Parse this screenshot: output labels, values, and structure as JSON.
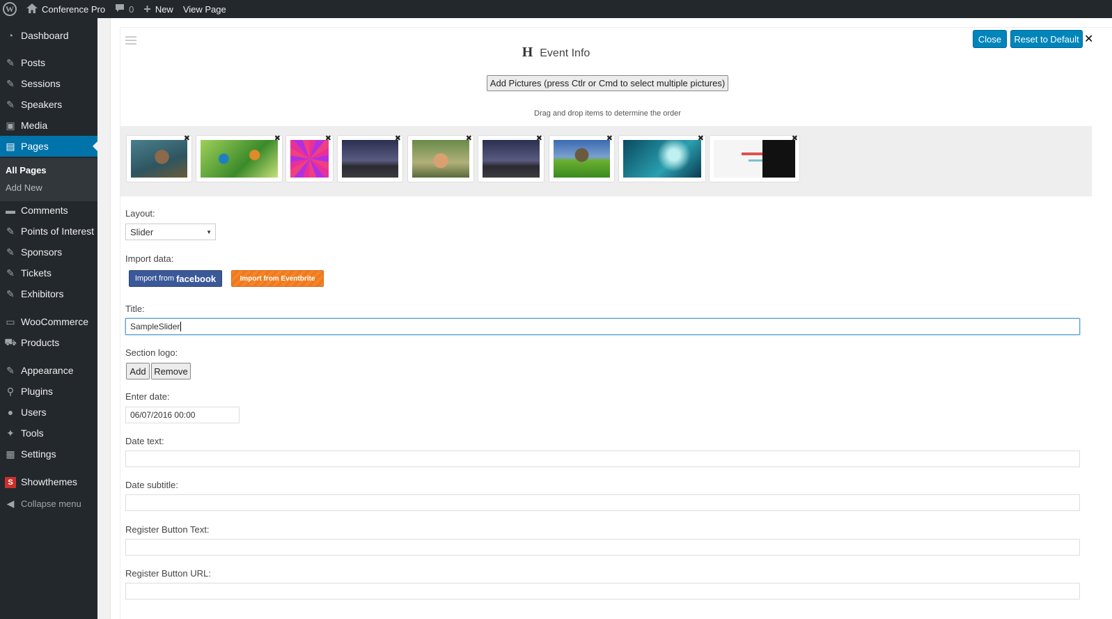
{
  "adminbar": {
    "site_name": "Conference Pro",
    "comments_count": "0",
    "new_label": "New",
    "view_page_label": "View Page"
  },
  "sidebar": {
    "items": [
      {
        "label": "Dashboard",
        "icon": "dashboard-icon"
      },
      {
        "label": "Posts",
        "icon": "pin-icon"
      },
      {
        "label": "Sessions",
        "icon": "pin-icon"
      },
      {
        "label": "Speakers",
        "icon": "pin-icon"
      },
      {
        "label": "Media",
        "icon": "media-icon"
      },
      {
        "label": "Pages",
        "icon": "pages-icon"
      },
      {
        "label": "Comments",
        "icon": "comment-icon"
      },
      {
        "label": "Points of Interest",
        "icon": "pin-icon"
      },
      {
        "label": "Sponsors",
        "icon": "pin-icon"
      },
      {
        "label": "Tickets",
        "icon": "pin-icon"
      },
      {
        "label": "Exhibitors",
        "icon": "pin-icon"
      },
      {
        "label": "WooCommerce",
        "icon": "woocommerce-icon"
      },
      {
        "label": "Products",
        "icon": "cart-icon"
      },
      {
        "label": "Appearance",
        "icon": "brush-icon"
      },
      {
        "label": "Plugins",
        "icon": "plugin-icon"
      },
      {
        "label": "Users",
        "icon": "user-icon"
      },
      {
        "label": "Tools",
        "icon": "wrench-icon"
      },
      {
        "label": "Settings",
        "icon": "settings-icon"
      },
      {
        "label": "Showthemes",
        "icon": "showthemes-icon"
      }
    ],
    "submenu": {
      "all_pages": "All Pages",
      "add_new": "Add New"
    },
    "collapse_label": "Collapse menu"
  },
  "header": {
    "title": "Event Info",
    "close_label": "Close",
    "reset_label": "Reset to Default",
    "add_pictures_label": "Add Pictures (press Ctlr or Cmd to select multiple pictures)",
    "drag_hint": "Drag and drop items to determine the order"
  },
  "gallery": {
    "thumbnails": [
      "otter",
      "kingfishers",
      "pink-swirl",
      "lightning-city",
      "hamster",
      "lightning-city",
      "dandelion-field",
      "water-drops",
      "website-screenshot"
    ]
  },
  "form": {
    "layout_label": "Layout:",
    "layout_value": "Slider",
    "import_label": "Import data:",
    "import_facebook_prefix": "Import from",
    "import_facebook_brand": "facebook",
    "import_eventbrite": "Import from Eventbrite",
    "title_label": "Title:",
    "title_value": "SampleSlider",
    "logo_label": "Section logo:",
    "logo_add": "Add",
    "logo_remove": "Remove",
    "date_label": "Enter date:",
    "date_value": "06/07/2016 00:00",
    "date_text_label": "Date text:",
    "date_subtitle_label": "Date subtitle:",
    "register_text_label": "Register Button Text:",
    "register_url_label": "Register Button URL:"
  },
  "colors": {
    "accent": "#0073aa",
    "button_blue": "#0085ba",
    "facebook": "#3b5998",
    "eventbrite": "#f6852a",
    "sidebar": "#23282d"
  }
}
